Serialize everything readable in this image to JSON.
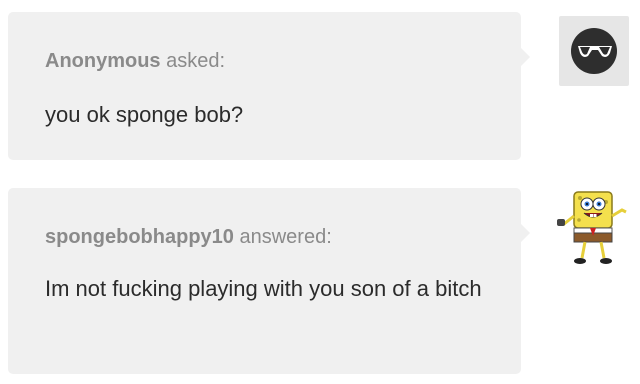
{
  "question": {
    "asker_name": "Anonymous",
    "action": "asked:",
    "text": "you ok sponge bob?"
  },
  "answer": {
    "answerer_name": "spongebobhappy10",
    "action": "answered:",
    "text": "Im not fucking playing with you son of a bitch"
  },
  "avatars": {
    "question": "anonymous-sunglasses-icon",
    "answer": "spongebob-icon"
  },
  "colors": {
    "bubble": "#f0f0f0",
    "header_text": "#8a8a8a",
    "body_text": "#2b2b2b"
  }
}
